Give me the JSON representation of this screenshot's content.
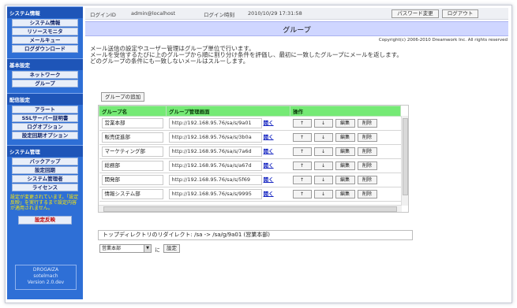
{
  "sidebar": {
    "sections": [
      {
        "title": "システム情報",
        "items": [
          "システム情報",
          "リソースモニタ",
          "メールキュー",
          "ログダウンロード"
        ]
      },
      {
        "title": "基本設定",
        "items": [
          "ネットワーク",
          "グループ"
        ]
      },
      {
        "title": "配信設定",
        "items": [
          "アラート",
          "SSLサーバー証明書",
          "ログオプション",
          "設定回期オプション"
        ]
      },
      {
        "title": "システム管理",
        "items": [
          "バックアップ",
          "設定回期",
          "システム管理者",
          "ライセンス"
        ]
      }
    ],
    "warning": "設定が変更されています。「設定反映」を実行するまで設定内容が適用されません。",
    "apply_label": "設定反映",
    "version_lines": [
      "DROGAIZA",
      "sotelmach",
      "Version 2.0.dev"
    ]
  },
  "topbar": {
    "login_id_label": "ログインID",
    "login_id_value": "admin@localhost",
    "login_time_label": "ログイン時刻",
    "login_time_value": "2010/10/29 17:31:58",
    "password_change": "パスワード変更",
    "logout": "ログアウト"
  },
  "page": {
    "title": "グループ",
    "copyright": "Copyright(c) 2006-2010 Dreamwork Inc. All rights reserved",
    "description": [
      "メール送信の設定やユーザー管理はグループ単位で行います。",
      "メールを受信するたびに上のグループから順に割り分け条件を評価し、最初に一致したグループにメールを返します。",
      "どのグループの条件にも一致しないメールはスルーします。"
    ],
    "add_group": "グループの追加"
  },
  "table": {
    "headers": [
      "グループ名",
      "グループ管理画面",
      "操作"
    ],
    "open_label": "開く",
    "up_label": "↑",
    "down_label": "↓",
    "edit_label": "編集",
    "delete_label": "削除",
    "rows": [
      {
        "name": "営業本部",
        "url": "http://192.168.95.76/sa/s/9a01"
      },
      {
        "name": "販売促進部",
        "url": "http://192.168.95.76/sa/s/3b0a"
      },
      {
        "name": "マーケティング部",
        "url": "http://192.168.95.76/sa/s/7a6d"
      },
      {
        "name": "総務部",
        "url": "http://192.168.95.76/sa/s/a67d"
      },
      {
        "name": "開発部",
        "url": "http://192.168.95.76/sa/s/5f69"
      },
      {
        "name": "情報システム部",
        "url": "http://192.168.95.76/sa/s/9995"
      }
    ]
  },
  "redirect": {
    "text": "トップディレクトリのリダイレクト: /sa -> /sa/g/9a01 (営業本部)"
  },
  "redirect_form": {
    "selected": "営業本部",
    "suffix": "に",
    "set_label": "設定"
  }
}
